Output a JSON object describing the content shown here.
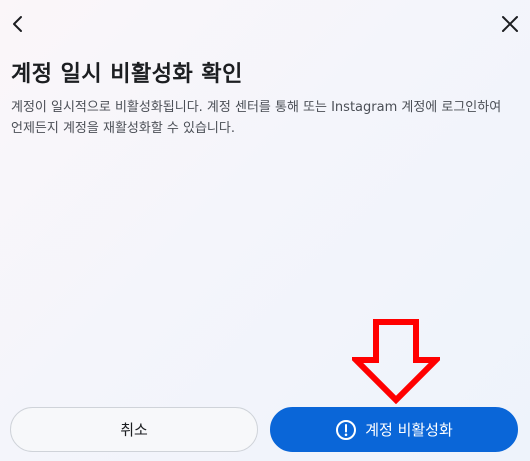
{
  "dialog": {
    "title": "계정 일시 비활성화 확인",
    "description": "계정이 일시적으로 비활성화됩니다. 계정 센터를 통해 또는 Instagram 계정에 로그인하여 언제든지 계정을 재활성화할 수 있습니다."
  },
  "header": {
    "back_icon": "chevron-left-icon",
    "close_icon": "close-icon"
  },
  "buttons": {
    "cancel_label": "취소",
    "confirm_label": "계정 비활성화",
    "confirm_icon": "alert-circle-icon"
  },
  "annotation": {
    "arrow_icon": "down-arrow-annotation",
    "arrow_color": "#ff0000"
  },
  "colors": {
    "primary": "#0a66d8",
    "text": "#1c1e21"
  }
}
